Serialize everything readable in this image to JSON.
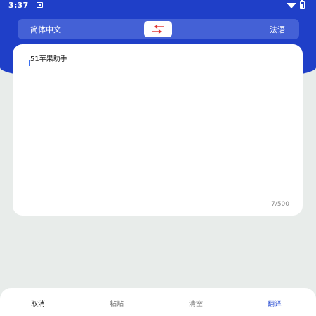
{
  "status_bar": {
    "time": "3:37"
  },
  "language_bar": {
    "source_language": "简体中文",
    "target_language": "法语"
  },
  "input": {
    "text": "51苹果助手",
    "char_count": "7/500"
  },
  "bottom_bar": {
    "cancel_label": "取消",
    "paste_label": "粘贴",
    "clear_label": "清空",
    "translate_label": "翻译"
  },
  "colors": {
    "primary": "#1f3fc8",
    "translate_active": "#2b4fd3",
    "background": "#e8ecea"
  }
}
